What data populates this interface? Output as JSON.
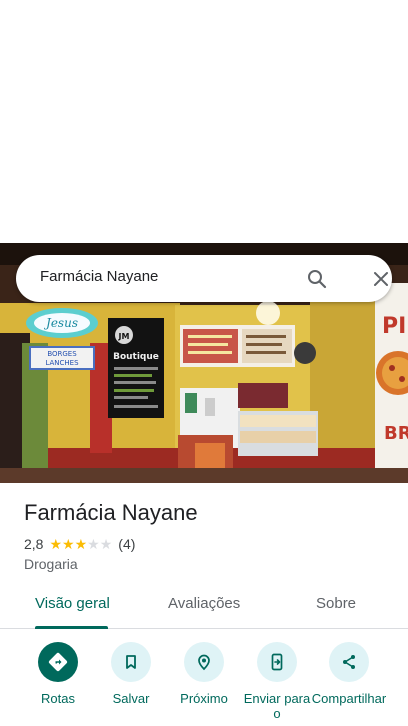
{
  "search": {
    "query": "Farmácia Nayane"
  },
  "place": {
    "name": "Farmácia Nayane",
    "rating": "2,8",
    "stars_filled": 3,
    "stars_total": 5,
    "review_count": "(4)",
    "category": "Drogaria"
  },
  "photo_signs": {
    "jesus": "Jesus",
    "borges_line1": "BORGES",
    "borges_line2": "LANCHES",
    "boutique_logo": "JM",
    "boutique_name": "Boutique"
  },
  "tabs": [
    {
      "label": "Visão geral",
      "active": true
    },
    {
      "label": "Avaliações",
      "active": false
    },
    {
      "label": "Sobre",
      "active": false
    }
  ],
  "actions": [
    {
      "label": "Rotas",
      "icon": "directions-icon"
    },
    {
      "label": "Salvar",
      "icon": "bookmark-icon"
    },
    {
      "label": "Próximo",
      "icon": "nearby-icon"
    },
    {
      "label": "Enviar para o",
      "icon": "send-to-phone-icon"
    },
    {
      "label": "Compartilhar",
      "icon": "share-icon"
    }
  ],
  "colors": {
    "accent": "#00695c",
    "action_bg": "#dff3f6",
    "star": "#fbbc04"
  }
}
